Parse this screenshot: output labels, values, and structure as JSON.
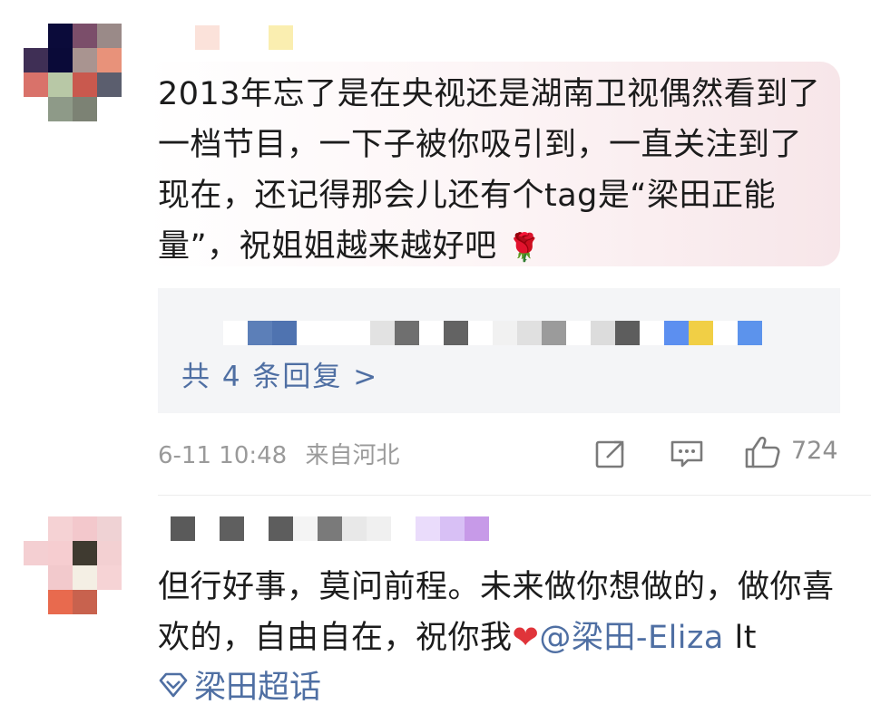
{
  "comments": [
    {
      "text": "2013年忘了是在央视还是湖南卫视偶然看到了一档节目，一下子被你吸引到，一直关注到了现在，还记得那会儿还有个tag是“梁田正能量”，祝姐姐越来越好吧",
      "emoji": "🌹",
      "replies_label": "共 4 条回复 >",
      "date": "6-11 10:48",
      "location": "来自河北",
      "likes": "724"
    },
    {
      "text": "但行好事，莫问前程。未来做你想做的，做你喜欢的，自由自在，祝你我",
      "emoji": "❤",
      "mention": "@梁田-Eliza",
      "trailing": " lt",
      "topic": "梁田超话"
    }
  ],
  "icons": [
    "repost-icon",
    "comment-icon",
    "like-icon",
    "rose-emoji-icon",
    "heart-emoji-icon",
    "topic-diamond-icon"
  ],
  "colors": {
    "link": "#4f6fa3",
    "text": "#1c1c1c",
    "meta": "#9a9a9a",
    "replies_bg": "#f4f5f7",
    "heart": "#e0343a"
  },
  "avatar_pixels_1": [
    "#ffffff",
    "#0b0b3a",
    "#7b4e6a",
    "#9a8a88",
    "#3f2f55",
    "#0a0a38",
    "#a99490",
    "#e8927a",
    "#d9726a",
    "#b8c8a6",
    "#c9594e",
    "#5b5e6e",
    "#ffffff",
    "#8e9a88",
    "#7c8274",
    "#ffffff"
  ],
  "avatar_pixels_2": [
    "#ffffff",
    "#f5d2d4",
    "#f3c8cc",
    "#efd2d4",
    "#f4cfd2",
    "#f6cdd0",
    "#3f3a30",
    "#f3d0d2",
    "#ffffff",
    "#f2c9cc",
    "#f4efe4",
    "#f6d3d5",
    "#ffffff",
    "#e86a4e",
    "#c8624e",
    "#ffffff"
  ],
  "name_strip_1": [
    "#ffffff",
    "#fbe2da",
    "#ffffff",
    "#ffffff",
    "#faeeb0"
  ],
  "name_strip_2": [
    "#5a5a5a",
    "#ffffff",
    "#5f5f5f",
    "#ffffff",
    "#5d5d5d",
    "#f4f4f4",
    "#7a7a7a",
    "#e8e8e8",
    "#f0f0f0",
    "#ffffff",
    "#eadcfb",
    "#d8c0f5",
    "#c79ae8"
  ],
  "reply_strip": [
    "#ffffff",
    "#5c7fb8",
    "#4f73b0",
    "#ffffff",
    "#ffffff",
    "#ffffff",
    "#e2e2e2",
    "#6f6f6f",
    "#ffffff",
    "#636363",
    "#ffffff",
    "#f1f1f1",
    "#e0e0e0",
    "#9b9b9b",
    "#ffffff",
    "#dcdcdc",
    "#5d5d5d",
    "#ffffff",
    "#5c8ff0",
    "#f1cf45",
    "#ffffff",
    "#5c93ec"
  ]
}
